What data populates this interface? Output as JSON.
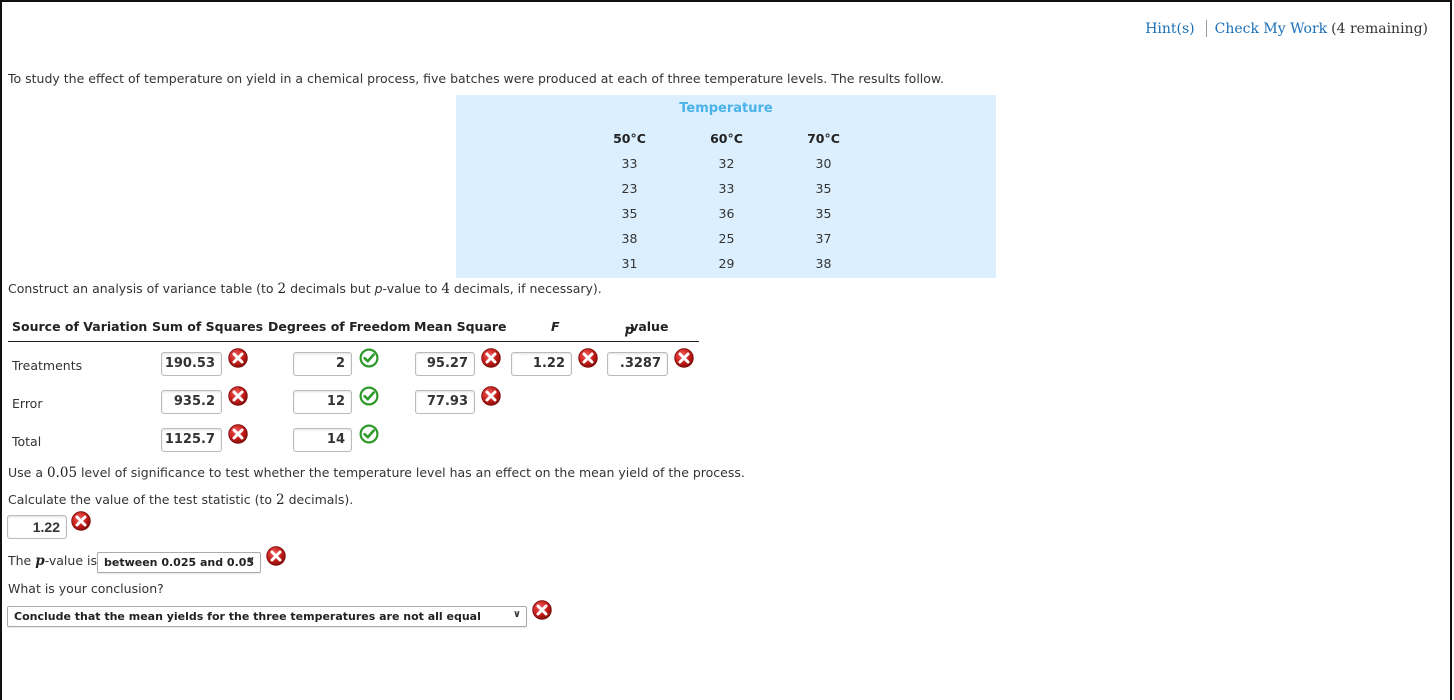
{
  "header": {
    "hint_label": "Hint(s)",
    "check_label": "Check My Work",
    "remaining": "(4 remaining)"
  },
  "problem": {
    "intro": "To study the effect of temperature on yield in a chemical process, five batches were produced at each of three temperature levels. The results follow.",
    "data_table": {
      "caption": "Temperature",
      "columns": [
        "50°C",
        "60°C",
        "70°C"
      ],
      "rows": [
        [
          "33",
          "32",
          "30"
        ],
        [
          "23",
          "33",
          "35"
        ],
        [
          "35",
          "36",
          "35"
        ],
        [
          "38",
          "25",
          "37"
        ],
        [
          "31",
          "29",
          "38"
        ]
      ]
    },
    "anova_instruction": {
      "part1": "Construct an analysis of variance table (to ",
      "num1": "2",
      "part2": " decimals but ",
      "p": "p",
      "part3": "-value to ",
      "num2": "4",
      "part4": " decimals, if necessary)."
    }
  },
  "anova": {
    "headers": [
      "Source of Variation",
      "Sum of Squares",
      "Degrees of Freedom",
      "Mean Square",
      "F",
      "p-value"
    ],
    "rows": [
      {
        "source": "Treatments",
        "ss": "190.53",
        "ss_status": "incorrect",
        "df": "2",
        "df_status": "correct",
        "ms": "95.27",
        "ms_status": "incorrect",
        "f": "1.22",
        "f_status": "incorrect",
        "p": ".3287",
        "p_status": "incorrect"
      },
      {
        "source": "Error",
        "ss": "935.2",
        "ss_status": "incorrect",
        "df": "12",
        "df_status": "correct",
        "ms": "77.93",
        "ms_status": "incorrect"
      },
      {
        "source": "Total",
        "ss": "1125.7",
        "ss_status": "incorrect",
        "df": "14",
        "df_status": "correct"
      }
    ]
  },
  "test": {
    "significance_part1": "Use a ",
    "alpha": "0.05",
    "significance_part2": " level of significance to test whether the temperature level has an effect on the mean yield of the process.",
    "stat_part1": "Calculate the value of the test statistic (to ",
    "stat_num": "2",
    "stat_part2": " decimals).",
    "stat_value": "1.22",
    "stat_status": "incorrect",
    "pvalue_prefix": "The ",
    "pvalue_p": "p",
    "pvalue_suffix": "-value is",
    "pvalue_selected": "between 0.025 and 0.05",
    "pvalue_status": "incorrect",
    "conclusion_question": "What is your conclusion?",
    "conclusion_selected": "Conclude that the mean yields for the three temperatures are not all equal",
    "conclusion_status": "incorrect"
  },
  "colors": {
    "link": "#1a6fb5",
    "data_box_bg": "#dcefff",
    "caption": "#49b2e8",
    "incorrect": "#c0201c",
    "correct": "#2e9a2a"
  }
}
